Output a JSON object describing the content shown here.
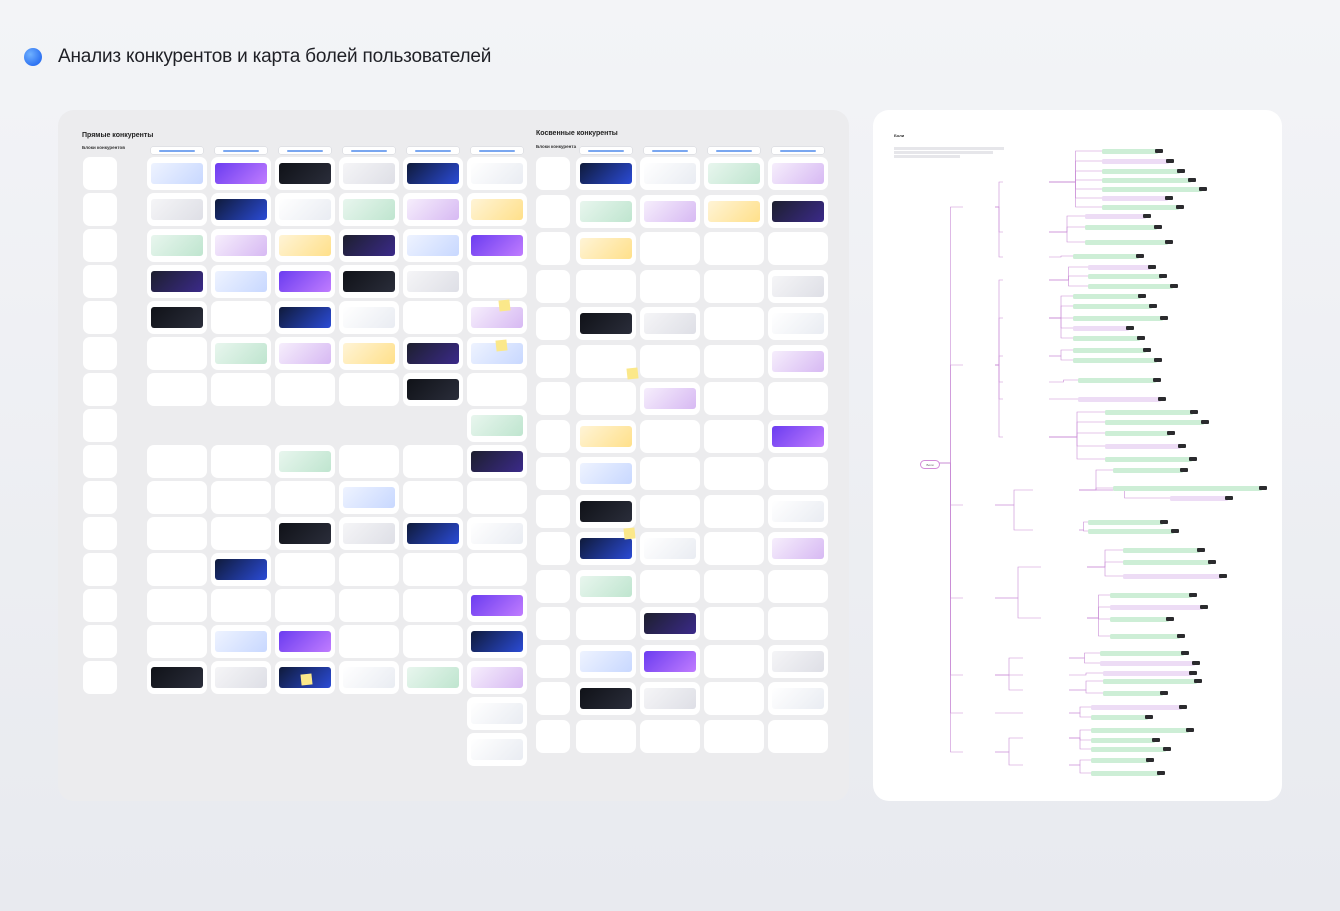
{
  "header": {
    "title": "Анализ конкурентов и карта болей пользователей",
    "accent": "#3a82f7"
  },
  "board": {
    "direct": {
      "title": "Прямые конкуренты",
      "subtitle": "Блоки конкурентов"
    },
    "indirect": {
      "title": "Косвенные конкуренты",
      "subtitle": "Блоки конкурента"
    }
  },
  "mindmap": {
    "title": "Боли",
    "root": "Боли"
  }
}
